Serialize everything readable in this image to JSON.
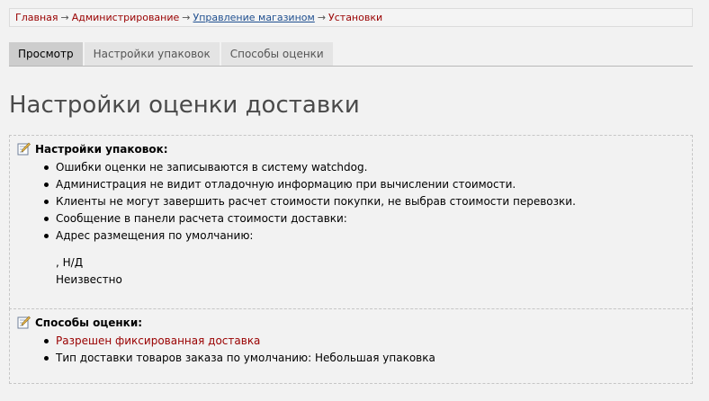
{
  "breadcrumb": {
    "items": [
      {
        "label": "Главная",
        "link": false
      },
      {
        "label": "Администрирование",
        "link": false
      },
      {
        "label": "Управление магазином",
        "link": true
      },
      {
        "label": "Установки",
        "link": false
      }
    ],
    "separator": "→"
  },
  "tabs": [
    {
      "label": "Просмотр",
      "active": true
    },
    {
      "label": "Настройки упаковок",
      "active": false
    },
    {
      "label": "Способы оценки",
      "active": false
    }
  ],
  "page_title": "Настройки оценки доставки",
  "sections": [
    {
      "icon": "edit-icon",
      "heading": "Настройки упаковок:",
      "items": [
        "Ошибки оценки не записываются в систему watchdog.",
        "Администрация не видит отладочную информацию при вычислении стоимости.",
        "Клиенты не могут завершить расчет стоимости покупки, не выбрав стоимости перевозки.",
        "Сообщение в панели расчета стоимости доставки:",
        "Адрес размещения по умолчанию:"
      ],
      "address_lines": [
        ", Н/Д",
        "Неизвестно"
      ]
    },
    {
      "icon": "edit-icon",
      "heading": "Способы оценки:",
      "items": [
        "Разрешен фиксированная доставка",
        "Тип доставки товаров заказа по умолчанию: Небольшая упаковка"
      ]
    }
  ],
  "colors": {
    "link_red": "#990000",
    "link_blue": "#1f4f8f",
    "background": "#f2f2f2",
    "tab_active": "#cdcdcd",
    "tab_inactive": "#e4e4e4"
  }
}
